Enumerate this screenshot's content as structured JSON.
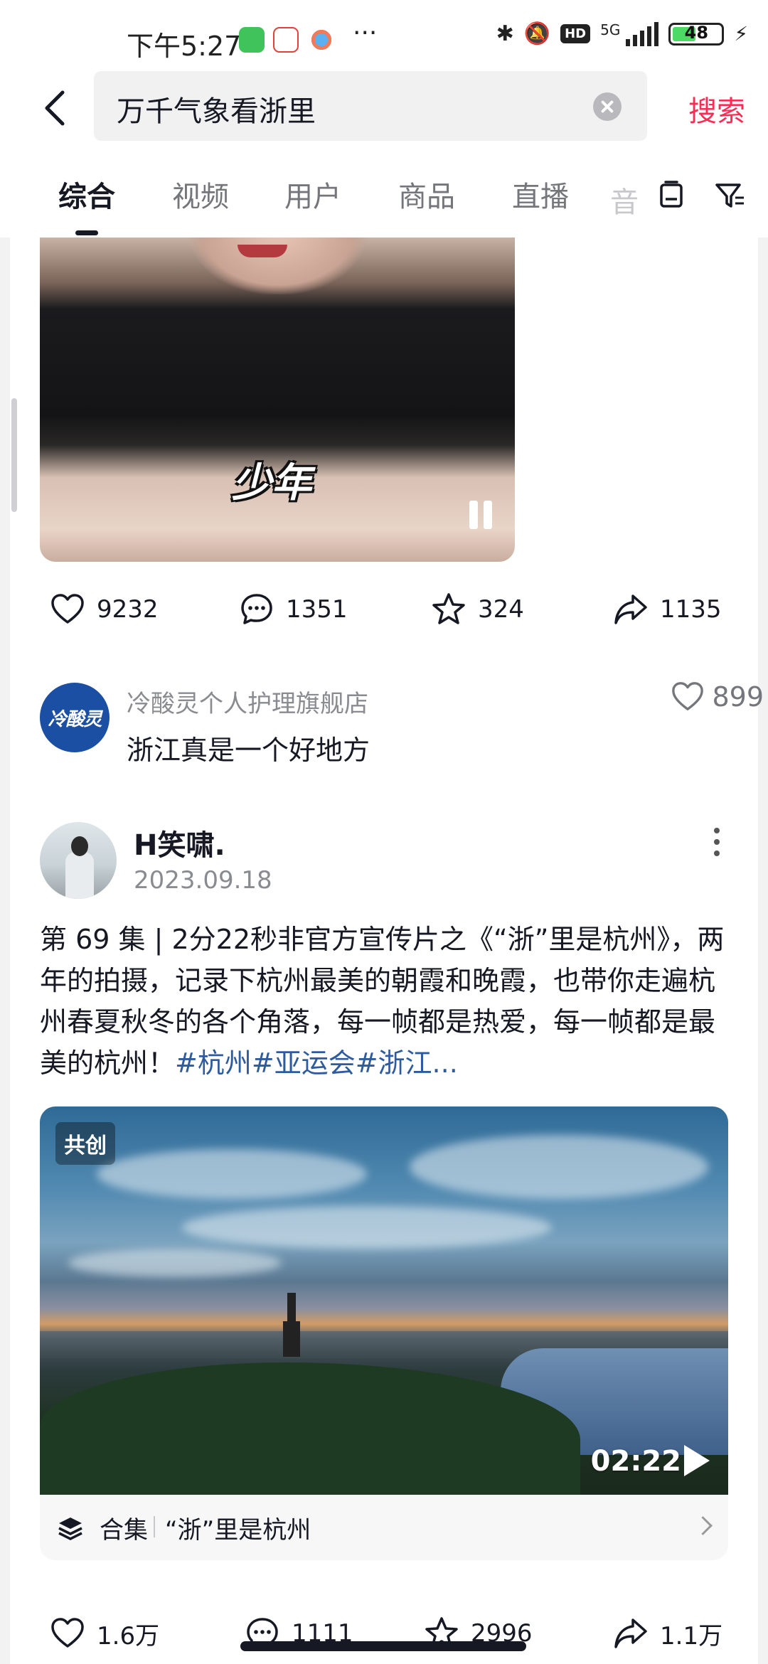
{
  "status_bar": {
    "time": "下午5:27",
    "network": "5G",
    "battery": "48",
    "hd": "HD"
  },
  "search": {
    "query": "万千气象看浙里",
    "button": "搜索"
  },
  "tabs": [
    "综合",
    "视频",
    "用户",
    "商品",
    "直播",
    "音"
  ],
  "post1": {
    "overlay_text": "少年",
    "stats": {
      "likes": "9232",
      "comments": "1351",
      "favorites": "324",
      "shares": "1135"
    },
    "top_comment": {
      "avatar_text": "冷酸灵",
      "user": "冷酸灵个人护理旗舰店",
      "text": "浙江真是一个好地方",
      "likes": "899"
    }
  },
  "post2": {
    "username": "H笑啸.",
    "date": "2023.09.18",
    "description": "第 69 集 | 2分22秒非官方宣传片之《“浙”里是杭州》，两年的拍摄，记录下杭州最美的朝霞和晚霞，也带你走遍杭州春夏秋冬的各个角落，每一帧都是热爱，每一帧都是最美的杭州！",
    "tags": "#杭州#亚运会#浙江...",
    "badge": "共创",
    "duration": "02:22",
    "collection_label": "合集",
    "collection_title": "“浙”里是杭州",
    "stats": {
      "likes": "1.6万",
      "comments": "1111",
      "favorites": "2996",
      "shares": "1.1万"
    }
  },
  "colors": {
    "accent": "#fe2c55",
    "tag": "#2e5b9d",
    "text": "#161823",
    "muted": "#8a8b91"
  }
}
